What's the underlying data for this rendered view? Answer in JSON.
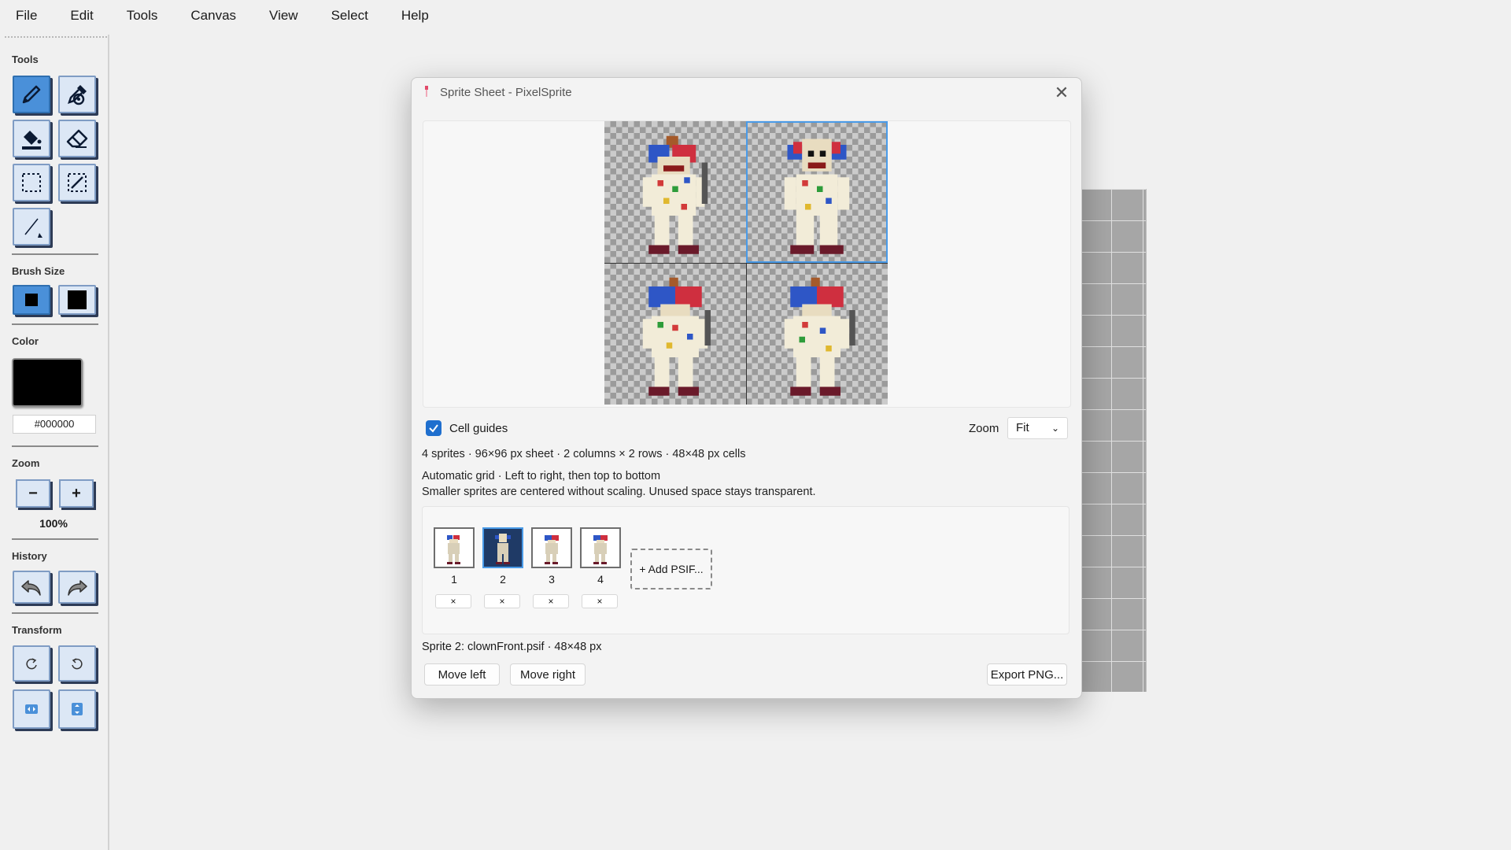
{
  "menu": [
    "File",
    "Edit",
    "Tools",
    "Canvas",
    "View",
    "Select",
    "Help"
  ],
  "tools_panel": {
    "tools_label": "Tools",
    "tools": [
      "pencil-icon",
      "eyedropper-icon",
      "fill-bucket-icon",
      "eraser-icon",
      "rect-select-icon",
      "magic-select-icon",
      "line-icon"
    ],
    "brush_label": "Brush Size",
    "color_label": "Color",
    "color_value": "#000000",
    "zoom_label": "Zoom",
    "zoom_minus": "−",
    "zoom_plus": "+",
    "zoom_value": "100%",
    "history_label": "History",
    "transform_label": "Transform"
  },
  "dialog": {
    "title": "Sprite Sheet - PixelSprite",
    "close": "✕",
    "cell_guides_label": "Cell guides",
    "cell_guides_checked": true,
    "zoom_label": "Zoom",
    "zoom_selected": "Fit",
    "summary": "4 sprites · 96×96 px sheet · 2 columns × 2 rows · 48×48 px cells",
    "layout_line1": "Automatic grid · Left to right, then top to bottom",
    "layout_line2": "Smaller sprites are centered without scaling. Unused space stays transparent.",
    "sprites": [
      {
        "num": "1",
        "remove": "×"
      },
      {
        "num": "2",
        "remove": "×",
        "selected": true
      },
      {
        "num": "3",
        "remove": "×"
      },
      {
        "num": "4",
        "remove": "×"
      }
    ],
    "add_button": "+ Add PSIF...",
    "status": "Sprite 2: clownFront.psif · 48×48 px",
    "move_left": "Move left",
    "move_right": "Move right",
    "export": "Export PNG..."
  },
  "colors": {
    "accent": "#1f6fce",
    "selection": "#4a9be8",
    "tool_active": "#4a90d9"
  }
}
